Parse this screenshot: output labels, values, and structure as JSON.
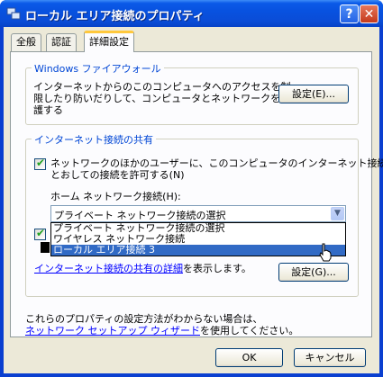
{
  "window": {
    "title": "ローカル エリア接続のプロパティ",
    "help_button": "?",
    "close_button": "✕"
  },
  "tabs": [
    {
      "label": "全般"
    },
    {
      "label": "認証"
    },
    {
      "label": "詳細設定"
    }
  ],
  "firewall": {
    "legend": "Windows ファイアウォール",
    "description_line1": "インターネットからのこのコンピュータへのアクセスを制",
    "description_line2": "限したり防いだりして、コンピュータとネットワークを保",
    "description_line3": "護する",
    "settings_button": "設定(E)..."
  },
  "ics": {
    "legend": "インターネット接続の共有",
    "allow_checkbox_line1": "ネットワークのほかのユーザーに、このコンピュータのインターネット接続を",
    "allow_checkbox_line2": "とおしての接続を許可する(N)",
    "allow_checked": true,
    "home_network_label": "ホーム ネットワーク接続(H):",
    "home_network_selected": "プライベート ネットワーク接続の選択",
    "dropdown_options": [
      "プライベート ネットワーク接続の選択",
      "ワイヤレス ネットワーク接続",
      "ローカル エリア接続 3"
    ],
    "dropdown_highlighted_index": 2,
    "second_checkbox_checked": true,
    "details_link": "インターネット接続の共有の詳細",
    "details_suffix": "を表示します。",
    "settings_button": "設定(G)..."
  },
  "footer_text": {
    "line1": "これらのプロパティの設定方法がわからない場合は、",
    "link": "ネットワーク セットアップ ウィザード",
    "line2_suffix": "を使用してください。"
  },
  "buttons": {
    "ok": "OK",
    "cancel": "キャンセル"
  },
  "colors": {
    "titlebar": "#0852e0",
    "dialog_bg": "#ece9d8",
    "group_legend": "#0046d5",
    "selection": "#316ac5",
    "link": "#0000ff"
  }
}
